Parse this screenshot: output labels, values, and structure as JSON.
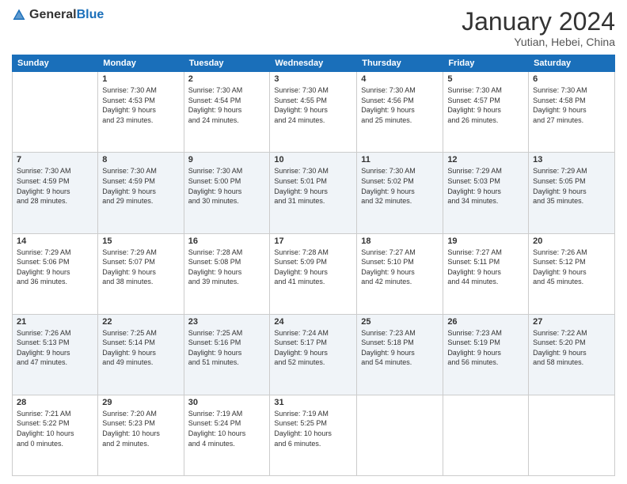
{
  "logo": {
    "general": "General",
    "blue": "Blue"
  },
  "header": {
    "month": "January 2024",
    "location": "Yutian, Hebei, China"
  },
  "days_of_week": [
    "Sunday",
    "Monday",
    "Tuesday",
    "Wednesday",
    "Thursday",
    "Friday",
    "Saturday"
  ],
  "weeks": [
    [
      {
        "day": "",
        "info": ""
      },
      {
        "day": "1",
        "info": "Sunrise: 7:30 AM\nSunset: 4:53 PM\nDaylight: 9 hours\nand 23 minutes."
      },
      {
        "day": "2",
        "info": "Sunrise: 7:30 AM\nSunset: 4:54 PM\nDaylight: 9 hours\nand 24 minutes."
      },
      {
        "day": "3",
        "info": "Sunrise: 7:30 AM\nSunset: 4:55 PM\nDaylight: 9 hours\nand 24 minutes."
      },
      {
        "day": "4",
        "info": "Sunrise: 7:30 AM\nSunset: 4:56 PM\nDaylight: 9 hours\nand 25 minutes."
      },
      {
        "day": "5",
        "info": "Sunrise: 7:30 AM\nSunset: 4:57 PM\nDaylight: 9 hours\nand 26 minutes."
      },
      {
        "day": "6",
        "info": "Sunrise: 7:30 AM\nSunset: 4:58 PM\nDaylight: 9 hours\nand 27 minutes."
      }
    ],
    [
      {
        "day": "7",
        "info": "Sunrise: 7:30 AM\nSunset: 4:59 PM\nDaylight: 9 hours\nand 28 minutes."
      },
      {
        "day": "8",
        "info": "Sunrise: 7:30 AM\nSunset: 4:59 PM\nDaylight: 9 hours\nand 29 minutes."
      },
      {
        "day": "9",
        "info": "Sunrise: 7:30 AM\nSunset: 5:00 PM\nDaylight: 9 hours\nand 30 minutes."
      },
      {
        "day": "10",
        "info": "Sunrise: 7:30 AM\nSunset: 5:01 PM\nDaylight: 9 hours\nand 31 minutes."
      },
      {
        "day": "11",
        "info": "Sunrise: 7:30 AM\nSunset: 5:02 PM\nDaylight: 9 hours\nand 32 minutes."
      },
      {
        "day": "12",
        "info": "Sunrise: 7:29 AM\nSunset: 5:03 PM\nDaylight: 9 hours\nand 34 minutes."
      },
      {
        "day": "13",
        "info": "Sunrise: 7:29 AM\nSunset: 5:05 PM\nDaylight: 9 hours\nand 35 minutes."
      }
    ],
    [
      {
        "day": "14",
        "info": "Sunrise: 7:29 AM\nSunset: 5:06 PM\nDaylight: 9 hours\nand 36 minutes."
      },
      {
        "day": "15",
        "info": "Sunrise: 7:29 AM\nSunset: 5:07 PM\nDaylight: 9 hours\nand 38 minutes."
      },
      {
        "day": "16",
        "info": "Sunrise: 7:28 AM\nSunset: 5:08 PM\nDaylight: 9 hours\nand 39 minutes."
      },
      {
        "day": "17",
        "info": "Sunrise: 7:28 AM\nSunset: 5:09 PM\nDaylight: 9 hours\nand 41 minutes."
      },
      {
        "day": "18",
        "info": "Sunrise: 7:27 AM\nSunset: 5:10 PM\nDaylight: 9 hours\nand 42 minutes."
      },
      {
        "day": "19",
        "info": "Sunrise: 7:27 AM\nSunset: 5:11 PM\nDaylight: 9 hours\nand 44 minutes."
      },
      {
        "day": "20",
        "info": "Sunrise: 7:26 AM\nSunset: 5:12 PM\nDaylight: 9 hours\nand 45 minutes."
      }
    ],
    [
      {
        "day": "21",
        "info": "Sunrise: 7:26 AM\nSunset: 5:13 PM\nDaylight: 9 hours\nand 47 minutes."
      },
      {
        "day": "22",
        "info": "Sunrise: 7:25 AM\nSunset: 5:14 PM\nDaylight: 9 hours\nand 49 minutes."
      },
      {
        "day": "23",
        "info": "Sunrise: 7:25 AM\nSunset: 5:16 PM\nDaylight: 9 hours\nand 51 minutes."
      },
      {
        "day": "24",
        "info": "Sunrise: 7:24 AM\nSunset: 5:17 PM\nDaylight: 9 hours\nand 52 minutes."
      },
      {
        "day": "25",
        "info": "Sunrise: 7:23 AM\nSunset: 5:18 PM\nDaylight: 9 hours\nand 54 minutes."
      },
      {
        "day": "26",
        "info": "Sunrise: 7:23 AM\nSunset: 5:19 PM\nDaylight: 9 hours\nand 56 minutes."
      },
      {
        "day": "27",
        "info": "Sunrise: 7:22 AM\nSunset: 5:20 PM\nDaylight: 9 hours\nand 58 minutes."
      }
    ],
    [
      {
        "day": "28",
        "info": "Sunrise: 7:21 AM\nSunset: 5:22 PM\nDaylight: 10 hours\nand 0 minutes."
      },
      {
        "day": "29",
        "info": "Sunrise: 7:20 AM\nSunset: 5:23 PM\nDaylight: 10 hours\nand 2 minutes."
      },
      {
        "day": "30",
        "info": "Sunrise: 7:19 AM\nSunset: 5:24 PM\nDaylight: 10 hours\nand 4 minutes."
      },
      {
        "day": "31",
        "info": "Sunrise: 7:19 AM\nSunset: 5:25 PM\nDaylight: 10 hours\nand 6 minutes."
      },
      {
        "day": "",
        "info": ""
      },
      {
        "day": "",
        "info": ""
      },
      {
        "day": "",
        "info": ""
      }
    ]
  ]
}
